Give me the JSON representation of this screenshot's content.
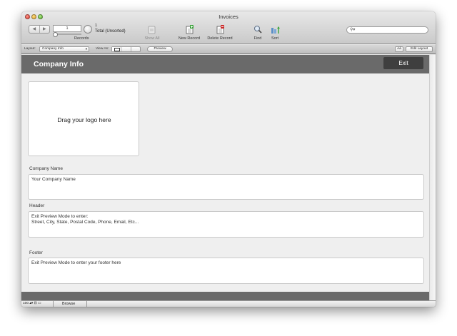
{
  "window": {
    "title": "Invoices"
  },
  "toolbar": {
    "record_current": "1",
    "record_count": "1",
    "record_total": "Total (Unsorted)",
    "records_label": "Records",
    "show_all_label": "Show All",
    "new_record_label": "New Record",
    "delete_record_label": "Delete Record",
    "find_label": "Find",
    "sort_label": "Sort",
    "search_placeholder": ""
  },
  "layout_bar": {
    "layout_label": "Layout:",
    "layout_value": "Company Info",
    "view_as_label": "View As:",
    "preview_label": "Preview",
    "aa_label": "Aá",
    "edit_layout_label": "Edit Layout"
  },
  "page": {
    "header_title": "Company Info",
    "exit_label": "Exit",
    "logo_placeholder": "Drag your logo here",
    "fields": [
      {
        "label": "Company Name",
        "value": "Your Company Name"
      },
      {
        "label": "Header",
        "value": "Exit Preview Mode to enter:\nStreet, City, State, Postal Code, Phone, Email, Etc..."
      },
      {
        "label": "Footer",
        "value": "Exit Preview Mode to enter your footer here"
      }
    ]
  },
  "status_bar": {
    "zoom": "100",
    "mode": "Browse"
  },
  "colors": {
    "header_bar": "#6a6a6a",
    "exit_button": "#3f3f3f",
    "canvas": "#efefef",
    "new_record_icon_accent": "#3aa33a",
    "delete_record_icon_accent": "#cc2b2b"
  },
  "icons": {
    "prev_record": "triangle-left",
    "next_record": "triangle-right",
    "show_all": "document-stack",
    "new_record": "document-plus",
    "delete_record": "document-minus",
    "find": "magnifier",
    "sort": "sort-arrows",
    "search": "magnifier"
  }
}
